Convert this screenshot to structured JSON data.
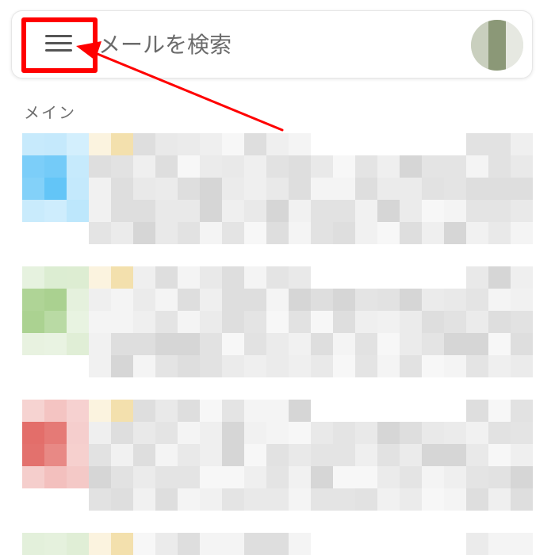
{
  "search": {
    "placeholder": "メールを検索"
  },
  "section": {
    "label": "メイン"
  },
  "colors": {
    "highlight": "#ff0000",
    "text_secondary": "#6e6e6e"
  },
  "icons": {
    "menu": "hamburger-menu-icon",
    "avatar": "account-avatar"
  },
  "mail_items": [
    {
      "avatar_color": "#5ec3f7",
      "blurred": true
    },
    {
      "avatar_color": "#a7d08c",
      "blurred": true
    },
    {
      "avatar_color": "#e26b66",
      "blurred": true
    },
    {
      "avatar_color": "#a7d08c",
      "blurred": true
    }
  ]
}
